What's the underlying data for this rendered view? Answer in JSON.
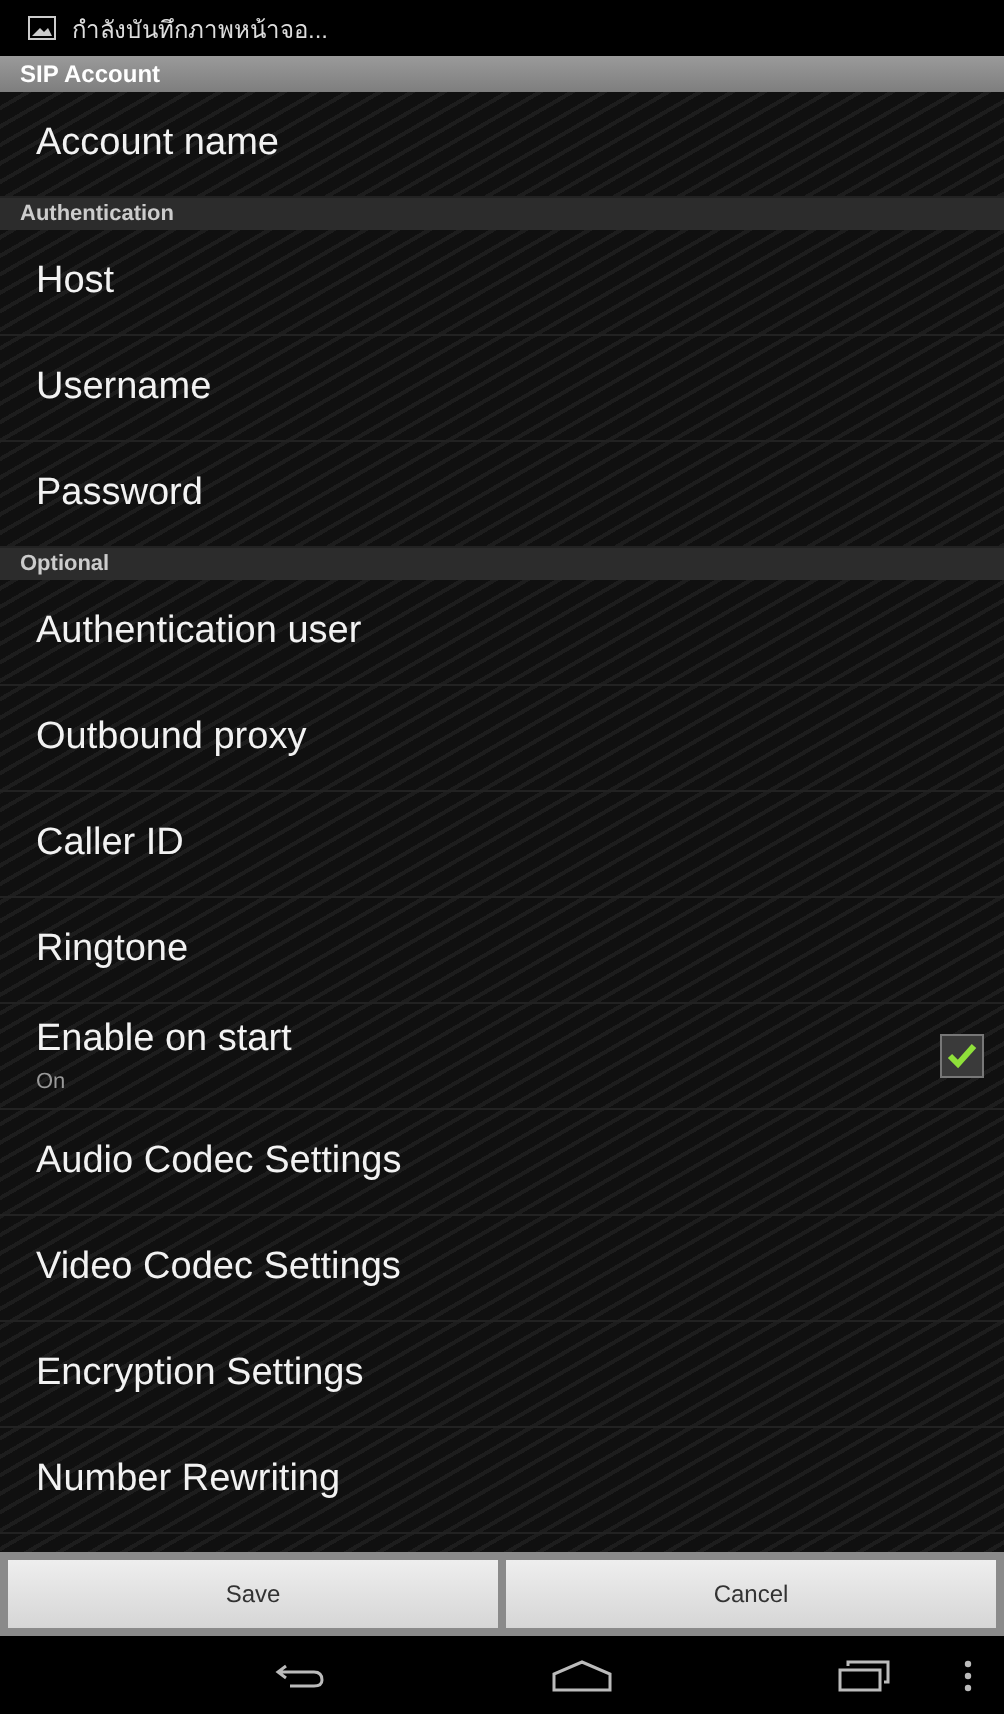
{
  "status_bar": {
    "notification": "กำลังบันทึกภาพหน้าจอ..."
  },
  "title": "SIP Account",
  "sections": [
    {
      "items": [
        {
          "kind": "item",
          "label": "Account name"
        }
      ]
    },
    {
      "header": "Authentication",
      "items": [
        {
          "kind": "item",
          "label": "Host"
        },
        {
          "kind": "item",
          "label": "Username"
        },
        {
          "kind": "item",
          "label": "Password"
        }
      ]
    },
    {
      "header": "Optional",
      "items": [
        {
          "kind": "item",
          "label": "Authentication user"
        },
        {
          "kind": "item",
          "label": "Outbound proxy"
        },
        {
          "kind": "item",
          "label": "Caller ID"
        },
        {
          "kind": "item",
          "label": "Ringtone"
        },
        {
          "kind": "checkbox",
          "label": "Enable on start",
          "summary": "On",
          "checked": true
        },
        {
          "kind": "item",
          "label": "Audio Codec Settings"
        },
        {
          "kind": "item",
          "label": "Video Codec Settings"
        },
        {
          "kind": "item",
          "label": "Encryption Settings"
        },
        {
          "kind": "item",
          "label": "Number Rewriting"
        }
      ]
    }
  ],
  "buttons": [
    "Save",
    "Cancel"
  ]
}
